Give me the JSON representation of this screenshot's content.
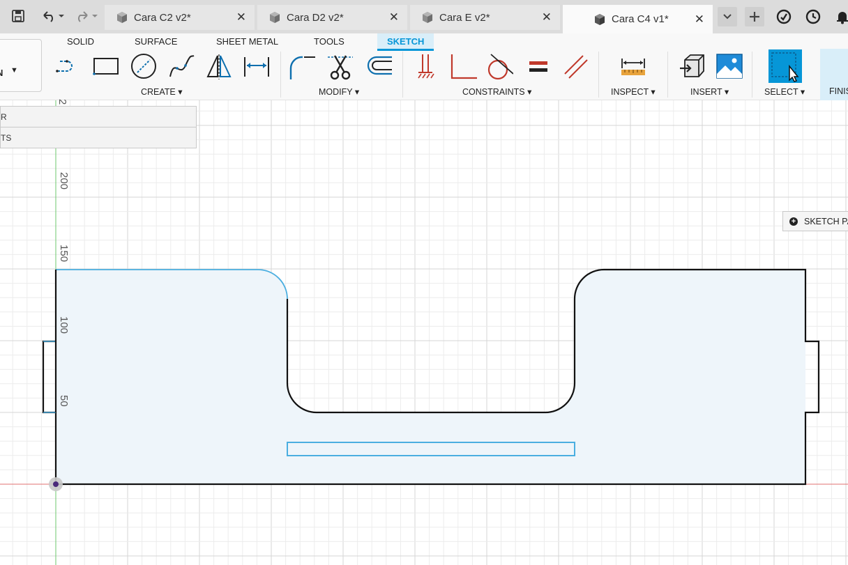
{
  "tabs": [
    {
      "label": "Cara C2 v2*",
      "active": false
    },
    {
      "label": "Cara D2 v2*",
      "active": false
    },
    {
      "label": "Cara E v2*",
      "active": false
    },
    {
      "label": "Cara C4 v1*",
      "active": true
    }
  ],
  "ribbon": {
    "tabs": [
      "SOLID",
      "SURFACE",
      "SHEET METAL",
      "TOOLS",
      "SKETCH"
    ],
    "active_tab": "SKETCH",
    "workspace_label": "N",
    "groups": {
      "create": "CREATE",
      "modify": "MODIFY",
      "constraints": "CONSTRAINTS",
      "inspect": "INSPECT",
      "insert": "INSERT",
      "select": "SELECT",
      "finish": "FINIS"
    }
  },
  "browser": {
    "row1": "R",
    "row2": "TS"
  },
  "sketch_palette": "SKETCH PA",
  "axis": {
    "y_ticks": [
      "200",
      "150",
      "100",
      "50"
    ],
    "partial_tick": "2"
  },
  "colors": {
    "accent": "#0696d7",
    "sketch_fill": "#eef5fa",
    "selected_curve": "#4aaee0",
    "x_axis": "#e06060",
    "y_axis": "#6cc86c",
    "grid_major": "#d5d5d5",
    "grid_minor": "#ececec"
  },
  "icons": [
    "save-icon",
    "undo-icon",
    "redo-icon",
    "dropdown-chevron-icon",
    "new-tab-icon",
    "job-status-icon",
    "clock-icon",
    "notification-icon"
  ]
}
